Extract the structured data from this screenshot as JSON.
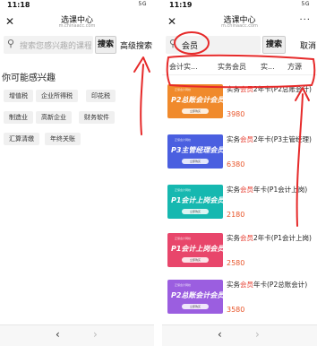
{
  "left": {
    "status": {
      "time": "11:18",
      "signal": "5G"
    },
    "header": {
      "title": "选课中心",
      "subtitle": "m.chinaacc.com"
    },
    "search": {
      "placeholder": "搜索您感兴趣的课程",
      "button": "搜索",
      "advanced": "高级搜索"
    },
    "interest_title": "你可能感兴趣",
    "tags": [
      "增值税",
      "企业所得税",
      "印花税",
      "制造业",
      "高新企业",
      "财务软件",
      "汇算清缴",
      "年终关账"
    ]
  },
  "right": {
    "status": {
      "time": "11:19",
      "signal": "5G"
    },
    "header": {
      "title": "选课中心",
      "subtitle": "m.chinaacc.com"
    },
    "search": {
      "value": "会员",
      "button": "搜索",
      "cancel": "取消"
    },
    "filters": [
      "会计实...",
      "实务会员",
      "实...",
      "实...",
      "方源"
    ],
    "items": [
      {
        "banner_top": "正保会计网校",
        "banner": "P2总账会计会员",
        "title_pre": "实务",
        "title_hl": "会员",
        "title_post": "2年卡(P2总账会计)",
        "price": "3980",
        "color": "#f08a2c"
      },
      {
        "banner_top": "正保会计网校",
        "banner": "P3主管经理会员",
        "title_pre": "实务",
        "title_hl": "会员",
        "title_post": "2年卡(P3主管经理)",
        "price": "6380",
        "color": "#4a5fe0"
      },
      {
        "banner_top": "正保会计网校",
        "banner": "P1会计上岗会员",
        "title_pre": "实务",
        "title_hl": "会员",
        "title_post": "年卡(P1会计上岗)",
        "price": "2180",
        "color": "#16b8b0"
      },
      {
        "banner_top": "正保会计网校",
        "banner": "P1会计上岗会员",
        "title_pre": "实务",
        "title_hl": "会员",
        "title_post": "2年卡(P1会计上岗)",
        "price": "2580",
        "color": "#e8466b"
      },
      {
        "banner_top": "正保会计网校",
        "banner": "P2总账会计会员",
        "title_pre": "实务",
        "title_hl": "会员",
        "title_post": "年卡(P2总账会计)",
        "price": "3580",
        "color": "#9b5ee0"
      }
    ],
    "pill": "立即购买"
  },
  "nav": {
    "back": "‹",
    "forward": "›"
  },
  "colors": {
    "annotation_red": "#e62a2a",
    "price": "#e8552a"
  }
}
